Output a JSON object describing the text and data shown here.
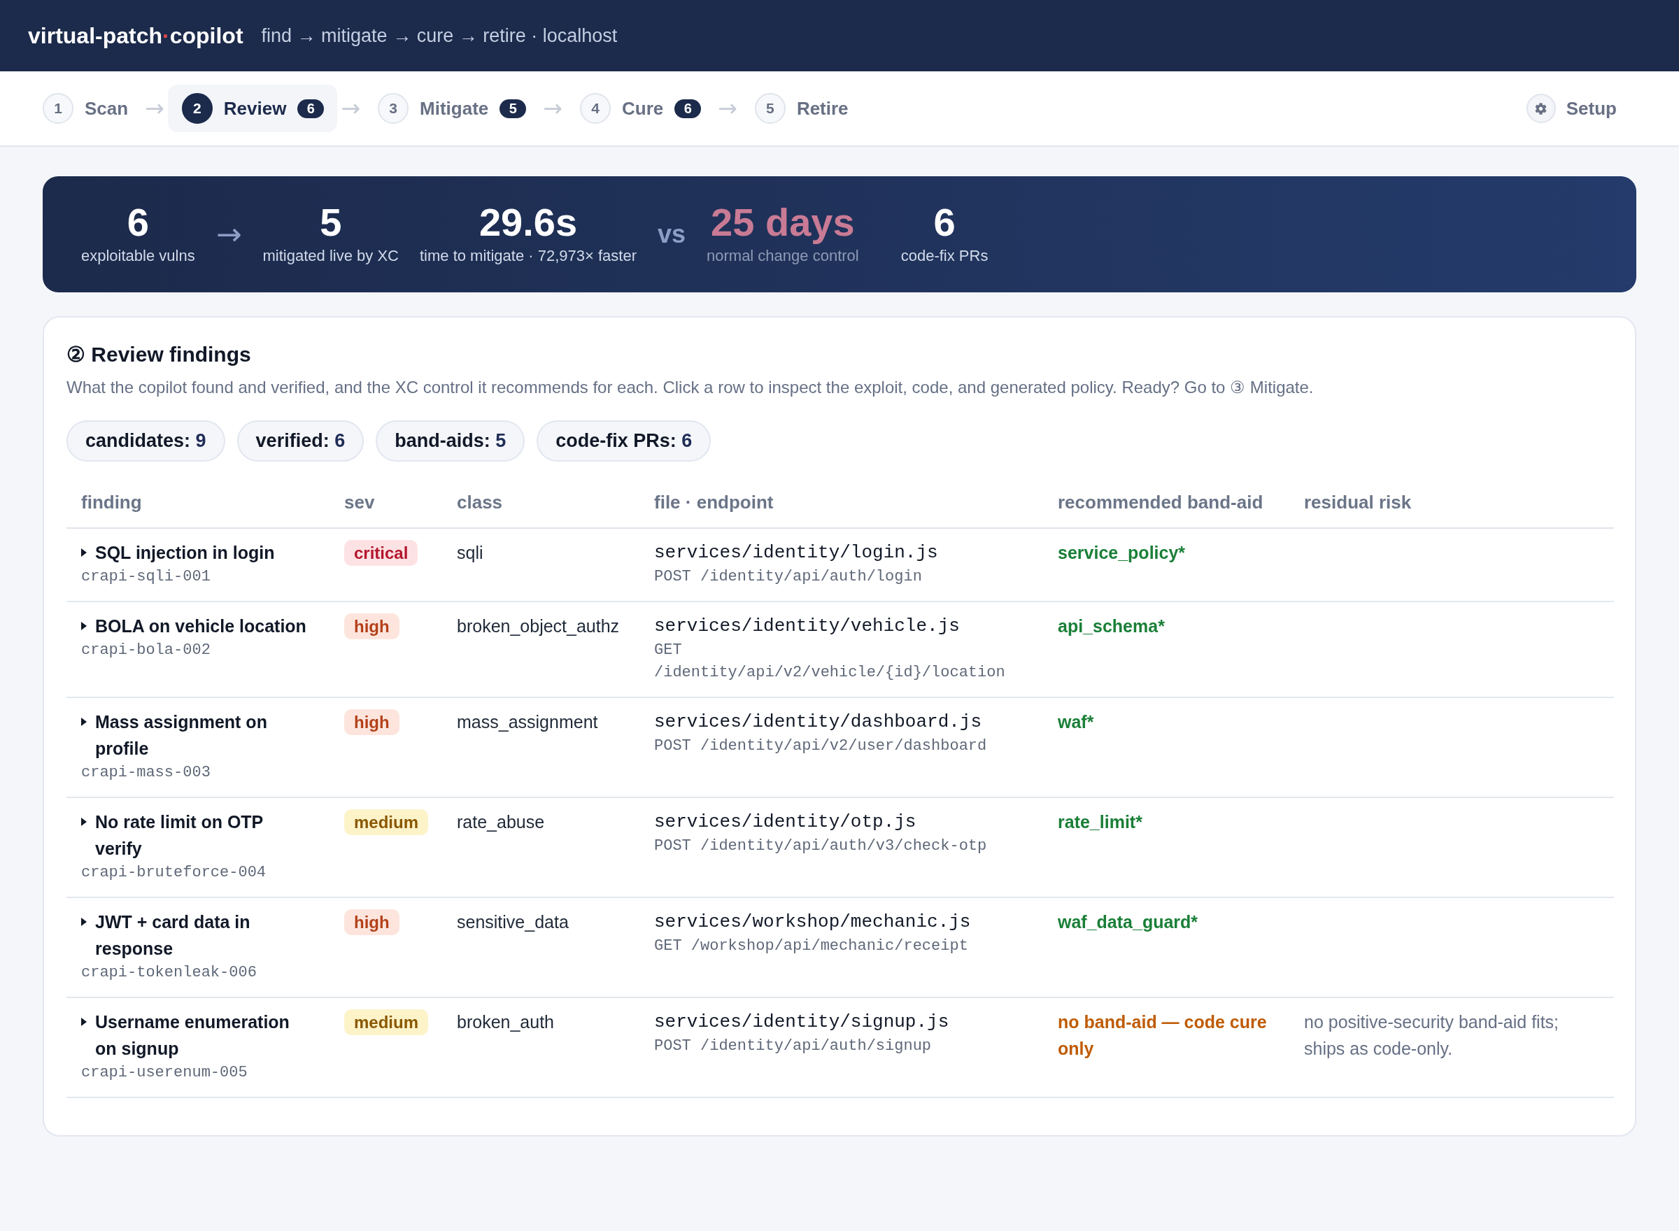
{
  "header": {
    "brand": {
      "prefix": "virtual-patch",
      "dot": "·",
      "suffix": "copilot"
    },
    "subtitle": "find → mitigate → cure → retire · localhost"
  },
  "stepper": {
    "steps": [
      {
        "number": "1",
        "label": "Scan",
        "selected": false
      },
      {
        "arrow_before": "→",
        "number": "2",
        "label": "Review",
        "count": "6",
        "selected": true
      },
      {
        "arrow_before": "→",
        "number": "3",
        "label": "Mitigate",
        "count": "5",
        "selected": false
      },
      {
        "arrow_before": "→",
        "number": "4",
        "label": "Cure",
        "count": "6",
        "selected": false
      },
      {
        "arrow_before": "→",
        "number": "5",
        "label": "Retire",
        "selected": false
      }
    ],
    "setup": {
      "label": "Setup"
    }
  },
  "summary": {
    "items": [
      {
        "kind": "stat",
        "value": "6",
        "label": "exploitable vulns"
      },
      {
        "kind": "arrow",
        "text": "→"
      },
      {
        "kind": "stat",
        "value": "5",
        "label": "mitigated live by XC"
      },
      {
        "kind": "stat",
        "value": "29.6s",
        "label": "time to mitigate · 72,973× faster"
      },
      {
        "kind": "vs",
        "text": "vs"
      },
      {
        "kind": "baseline",
        "value": "25 days",
        "label": "normal change control"
      },
      {
        "kind": "stat",
        "value": "6",
        "label": "code-fix PRs"
      }
    ]
  },
  "review": {
    "title": "② Review findings",
    "description": "What the copilot found and verified, and the XC control it recommends for each. Click a row to inspect the exploit, code, and generated policy. Ready? Go to ③ Mitigate.",
    "counts": [
      {
        "label": "candidates:",
        "value": "9"
      },
      {
        "label": "verified:",
        "value": "6"
      },
      {
        "label": "band-aids:",
        "value": "5"
      },
      {
        "label": "code-fix PRs:",
        "value": "6"
      }
    ],
    "table": {
      "columns": [
        "finding",
        "sev",
        "class",
        "file · endpoint",
        "recommended band-aid",
        "residual risk"
      ],
      "rows": [
        {
          "expanded": false,
          "title": "SQL injection in login",
          "id": "crapi-sqli-001",
          "severity": {
            "label": "critical",
            "kind": "critical"
          },
          "class": "sqli",
          "file": "services/identity/login.js",
          "endpoint": "POST /identity/api/auth/login",
          "band_aid": {
            "text": "service_policy*",
            "kind": "policy"
          }
        },
        {
          "expanded": false,
          "title": "BOLA on vehicle location",
          "id": "crapi-bola-002",
          "severity": {
            "label": "high",
            "kind": "high"
          },
          "class": "broken_object_authz",
          "file": "services/identity/vehicle.js",
          "endpoint": "GET /identity/api/v2/vehicle/{id}/location",
          "band_aid": {
            "text": "api_schema*",
            "kind": "policy"
          }
        },
        {
          "expanded": false,
          "title": "Mass assignment on profile",
          "id": "crapi-mass-003",
          "severity": {
            "label": "high",
            "kind": "high"
          },
          "class": "mass_assignment",
          "file": "services/identity/dashboard.js",
          "endpoint": "POST /identity/api/v2/user/dashboard",
          "band_aid": {
            "text": "waf*",
            "kind": "policy"
          }
        },
        {
          "expanded": false,
          "title": "No rate limit on OTP verify",
          "id": "crapi-bruteforce-004",
          "severity": {
            "label": "medium",
            "kind": "medium"
          },
          "class": "rate_abuse",
          "file": "services/identity/otp.js",
          "endpoint": "POST /identity/api/auth/v3/check-otp",
          "band_aid": {
            "text": "rate_limit*",
            "kind": "policy"
          }
        },
        {
          "expanded": false,
          "title": "JWT + card data in response",
          "id": "crapi-tokenleak-006",
          "severity": {
            "label": "high",
            "kind": "high"
          },
          "class": "sensitive_data",
          "file": "services/workshop/mechanic.js",
          "endpoint": "GET /workshop/api/mechanic/receipt",
          "band_aid": {
            "text": "waf_data_guard*",
            "kind": "policy"
          }
        },
        {
          "expanded": false,
          "title": "Username enumeration on signup",
          "id": "crapi-userenum-005",
          "severity": {
            "label": "medium",
            "kind": "medium"
          },
          "class": "broken_auth",
          "file": "services/identity/signup.js",
          "endpoint": "POST /identity/api/auth/signup",
          "band_aid": {
            "text": "no band-aid — code cure only",
            "kind": "none"
          },
          "residual_risk": "no positive-security band-aid fits; ships as code-only."
        }
      ]
    }
  }
}
